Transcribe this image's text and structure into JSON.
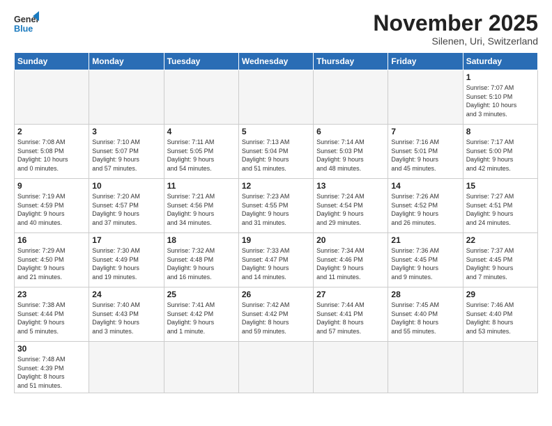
{
  "header": {
    "logo_general": "General",
    "logo_blue": "Blue",
    "month": "November 2025",
    "location": "Silenen, Uri, Switzerland"
  },
  "weekdays": [
    "Sunday",
    "Monday",
    "Tuesday",
    "Wednesday",
    "Thursday",
    "Friday",
    "Saturday"
  ],
  "weeks": [
    [
      {
        "day": "",
        "info": ""
      },
      {
        "day": "",
        "info": ""
      },
      {
        "day": "",
        "info": ""
      },
      {
        "day": "",
        "info": ""
      },
      {
        "day": "",
        "info": ""
      },
      {
        "day": "",
        "info": ""
      },
      {
        "day": "1",
        "info": "Sunrise: 7:07 AM\nSunset: 5:10 PM\nDaylight: 10 hours\nand 3 minutes."
      }
    ],
    [
      {
        "day": "2",
        "info": "Sunrise: 7:08 AM\nSunset: 5:08 PM\nDaylight: 10 hours\nand 0 minutes."
      },
      {
        "day": "3",
        "info": "Sunrise: 7:10 AM\nSunset: 5:07 PM\nDaylight: 9 hours\nand 57 minutes."
      },
      {
        "day": "4",
        "info": "Sunrise: 7:11 AM\nSunset: 5:05 PM\nDaylight: 9 hours\nand 54 minutes."
      },
      {
        "day": "5",
        "info": "Sunrise: 7:13 AM\nSunset: 5:04 PM\nDaylight: 9 hours\nand 51 minutes."
      },
      {
        "day": "6",
        "info": "Sunrise: 7:14 AM\nSunset: 5:03 PM\nDaylight: 9 hours\nand 48 minutes."
      },
      {
        "day": "7",
        "info": "Sunrise: 7:16 AM\nSunset: 5:01 PM\nDaylight: 9 hours\nand 45 minutes."
      },
      {
        "day": "8",
        "info": "Sunrise: 7:17 AM\nSunset: 5:00 PM\nDaylight: 9 hours\nand 42 minutes."
      }
    ],
    [
      {
        "day": "9",
        "info": "Sunrise: 7:19 AM\nSunset: 4:59 PM\nDaylight: 9 hours\nand 40 minutes."
      },
      {
        "day": "10",
        "info": "Sunrise: 7:20 AM\nSunset: 4:57 PM\nDaylight: 9 hours\nand 37 minutes."
      },
      {
        "day": "11",
        "info": "Sunrise: 7:21 AM\nSunset: 4:56 PM\nDaylight: 9 hours\nand 34 minutes."
      },
      {
        "day": "12",
        "info": "Sunrise: 7:23 AM\nSunset: 4:55 PM\nDaylight: 9 hours\nand 31 minutes."
      },
      {
        "day": "13",
        "info": "Sunrise: 7:24 AM\nSunset: 4:54 PM\nDaylight: 9 hours\nand 29 minutes."
      },
      {
        "day": "14",
        "info": "Sunrise: 7:26 AM\nSunset: 4:52 PM\nDaylight: 9 hours\nand 26 minutes."
      },
      {
        "day": "15",
        "info": "Sunrise: 7:27 AM\nSunset: 4:51 PM\nDaylight: 9 hours\nand 24 minutes."
      }
    ],
    [
      {
        "day": "16",
        "info": "Sunrise: 7:29 AM\nSunset: 4:50 PM\nDaylight: 9 hours\nand 21 minutes."
      },
      {
        "day": "17",
        "info": "Sunrise: 7:30 AM\nSunset: 4:49 PM\nDaylight: 9 hours\nand 19 minutes."
      },
      {
        "day": "18",
        "info": "Sunrise: 7:32 AM\nSunset: 4:48 PM\nDaylight: 9 hours\nand 16 minutes."
      },
      {
        "day": "19",
        "info": "Sunrise: 7:33 AM\nSunset: 4:47 PM\nDaylight: 9 hours\nand 14 minutes."
      },
      {
        "day": "20",
        "info": "Sunrise: 7:34 AM\nSunset: 4:46 PM\nDaylight: 9 hours\nand 11 minutes."
      },
      {
        "day": "21",
        "info": "Sunrise: 7:36 AM\nSunset: 4:45 PM\nDaylight: 9 hours\nand 9 minutes."
      },
      {
        "day": "22",
        "info": "Sunrise: 7:37 AM\nSunset: 4:45 PM\nDaylight: 9 hours\nand 7 minutes."
      }
    ],
    [
      {
        "day": "23",
        "info": "Sunrise: 7:38 AM\nSunset: 4:44 PM\nDaylight: 9 hours\nand 5 minutes."
      },
      {
        "day": "24",
        "info": "Sunrise: 7:40 AM\nSunset: 4:43 PM\nDaylight: 9 hours\nand 3 minutes."
      },
      {
        "day": "25",
        "info": "Sunrise: 7:41 AM\nSunset: 4:42 PM\nDaylight: 9 hours\nand 1 minute."
      },
      {
        "day": "26",
        "info": "Sunrise: 7:42 AM\nSunset: 4:42 PM\nDaylight: 8 hours\nand 59 minutes."
      },
      {
        "day": "27",
        "info": "Sunrise: 7:44 AM\nSunset: 4:41 PM\nDaylight: 8 hours\nand 57 minutes."
      },
      {
        "day": "28",
        "info": "Sunrise: 7:45 AM\nSunset: 4:40 PM\nDaylight: 8 hours\nand 55 minutes."
      },
      {
        "day": "29",
        "info": "Sunrise: 7:46 AM\nSunset: 4:40 PM\nDaylight: 8 hours\nand 53 minutes."
      }
    ],
    [
      {
        "day": "30",
        "info": "Sunrise: 7:48 AM\nSunset: 4:39 PM\nDaylight: 8 hours\nand 51 minutes."
      },
      {
        "day": "",
        "info": ""
      },
      {
        "day": "",
        "info": ""
      },
      {
        "day": "",
        "info": ""
      },
      {
        "day": "",
        "info": ""
      },
      {
        "day": "",
        "info": ""
      },
      {
        "day": "",
        "info": ""
      }
    ]
  ]
}
